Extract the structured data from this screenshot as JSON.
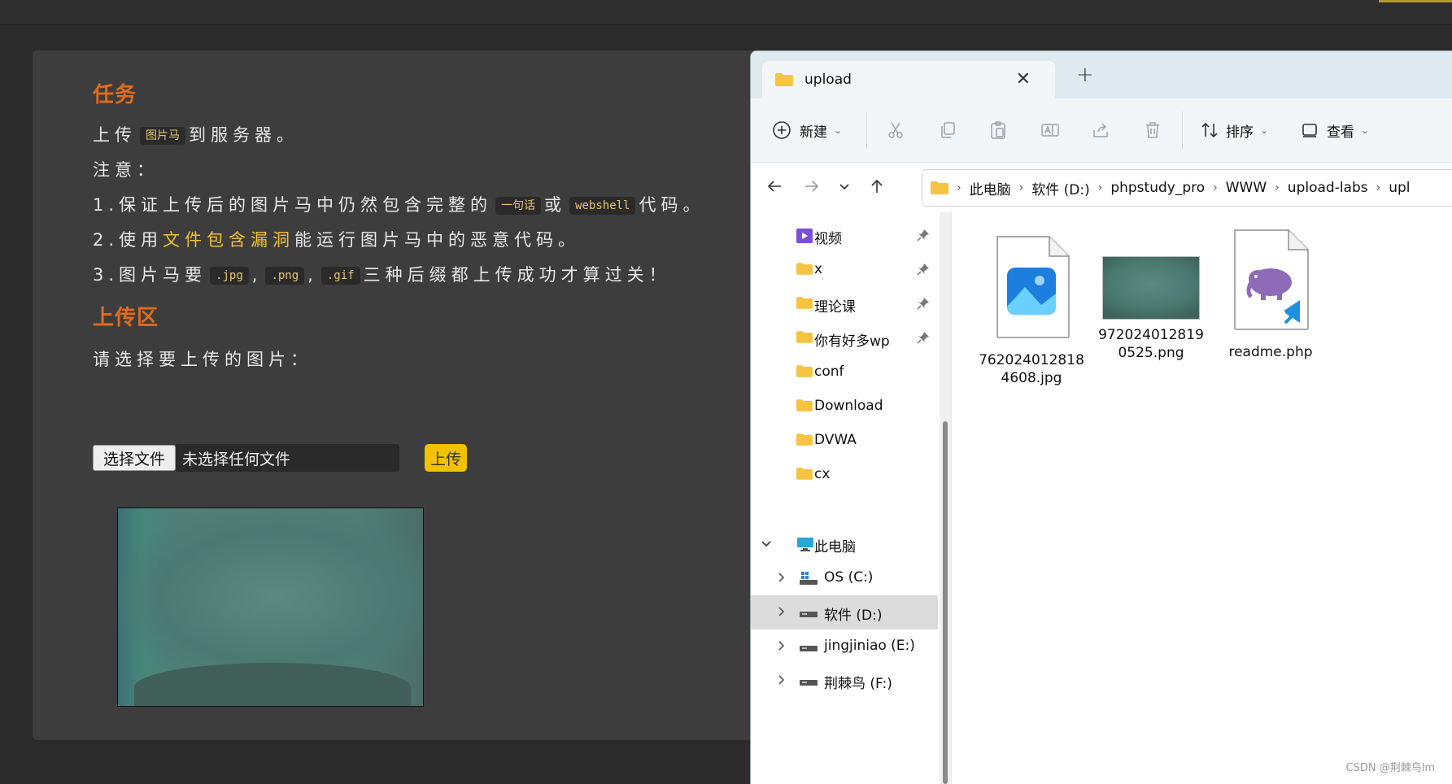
{
  "page": {
    "task_heading": "任务",
    "task_line": {
      "prefix": "上传",
      "code": "图片马",
      "suffix": "到服务器。"
    },
    "note_label": "注意：",
    "note1": {
      "prefix": "1.保证上传后的图片马中仍然包含完整的",
      "code1": "一句话",
      "mid": "或",
      "code2": "webshell",
      "suffix": "代码。"
    },
    "note2": {
      "prefix": "2.使用",
      "highlight": "文件包含漏洞",
      "suffix": "能运行图片马中的恶意代码。"
    },
    "note3": {
      "prefix": "3.图片马要",
      "code1": ".jpg",
      "sep1": ",",
      "code2": ".png",
      "sep2": ",",
      "code3": ".gif",
      "suffix": "三种后缀都上传成功才算过关！"
    },
    "upload_heading": "上传区",
    "select_prompt": "请选择要上传的图片：",
    "choose_button": "选择文件",
    "file_status": "未选择任何文件",
    "upload_button": "上传"
  },
  "explorer": {
    "tab_title": "upload",
    "toolbar": {
      "new_label": "新建",
      "sort_label": "排序",
      "view_label": "查看"
    },
    "breadcrumb": [
      "此电脑",
      "软件 (D:)",
      "phpstudy_pro",
      "WWW",
      "upload-labs",
      "upl"
    ],
    "quick_access": [
      {
        "label": "视频",
        "icon": "video-folder-icon",
        "pinned": true
      },
      {
        "label": "x",
        "icon": "folder-icon",
        "pinned": true
      },
      {
        "label": "理论课",
        "icon": "folder-icon",
        "pinned": true
      },
      {
        "label": "你有好多wp",
        "icon": "folder-icon",
        "pinned": true
      },
      {
        "label": "conf",
        "icon": "folder-icon",
        "pinned": false
      },
      {
        "label": "Download",
        "icon": "folder-icon",
        "pinned": false
      },
      {
        "label": "DVWA",
        "icon": "folder-icon",
        "pinned": false
      },
      {
        "label": "cx",
        "icon": "folder-icon",
        "pinned": false
      }
    ],
    "this_pc": "此电脑",
    "drives": [
      {
        "label": "OS (C:)",
        "selected": false
      },
      {
        "label": "软件 (D:)",
        "selected": true
      },
      {
        "label": "jingjiniao (E:)",
        "selected": false
      },
      {
        "label": "荆棘鸟 (F:)",
        "selected": false
      }
    ],
    "files": [
      {
        "name_line1": "762024012818",
        "name_line2": "4608.jpg",
        "icon": "image-file-icon"
      },
      {
        "name_line1": "972024012819",
        "name_line2": "0525.png",
        "icon": "image-thumbnail"
      },
      {
        "name_line1": "readme.php",
        "name_line2": "",
        "icon": "php-file-icon"
      }
    ]
  },
  "watermark": "CSDN @荆棘鸟lm",
  "colors": {
    "heading": "#e06b1e",
    "highlight": "#f2c230",
    "upload_button": "#f2c100",
    "folder": "#f6c342"
  }
}
